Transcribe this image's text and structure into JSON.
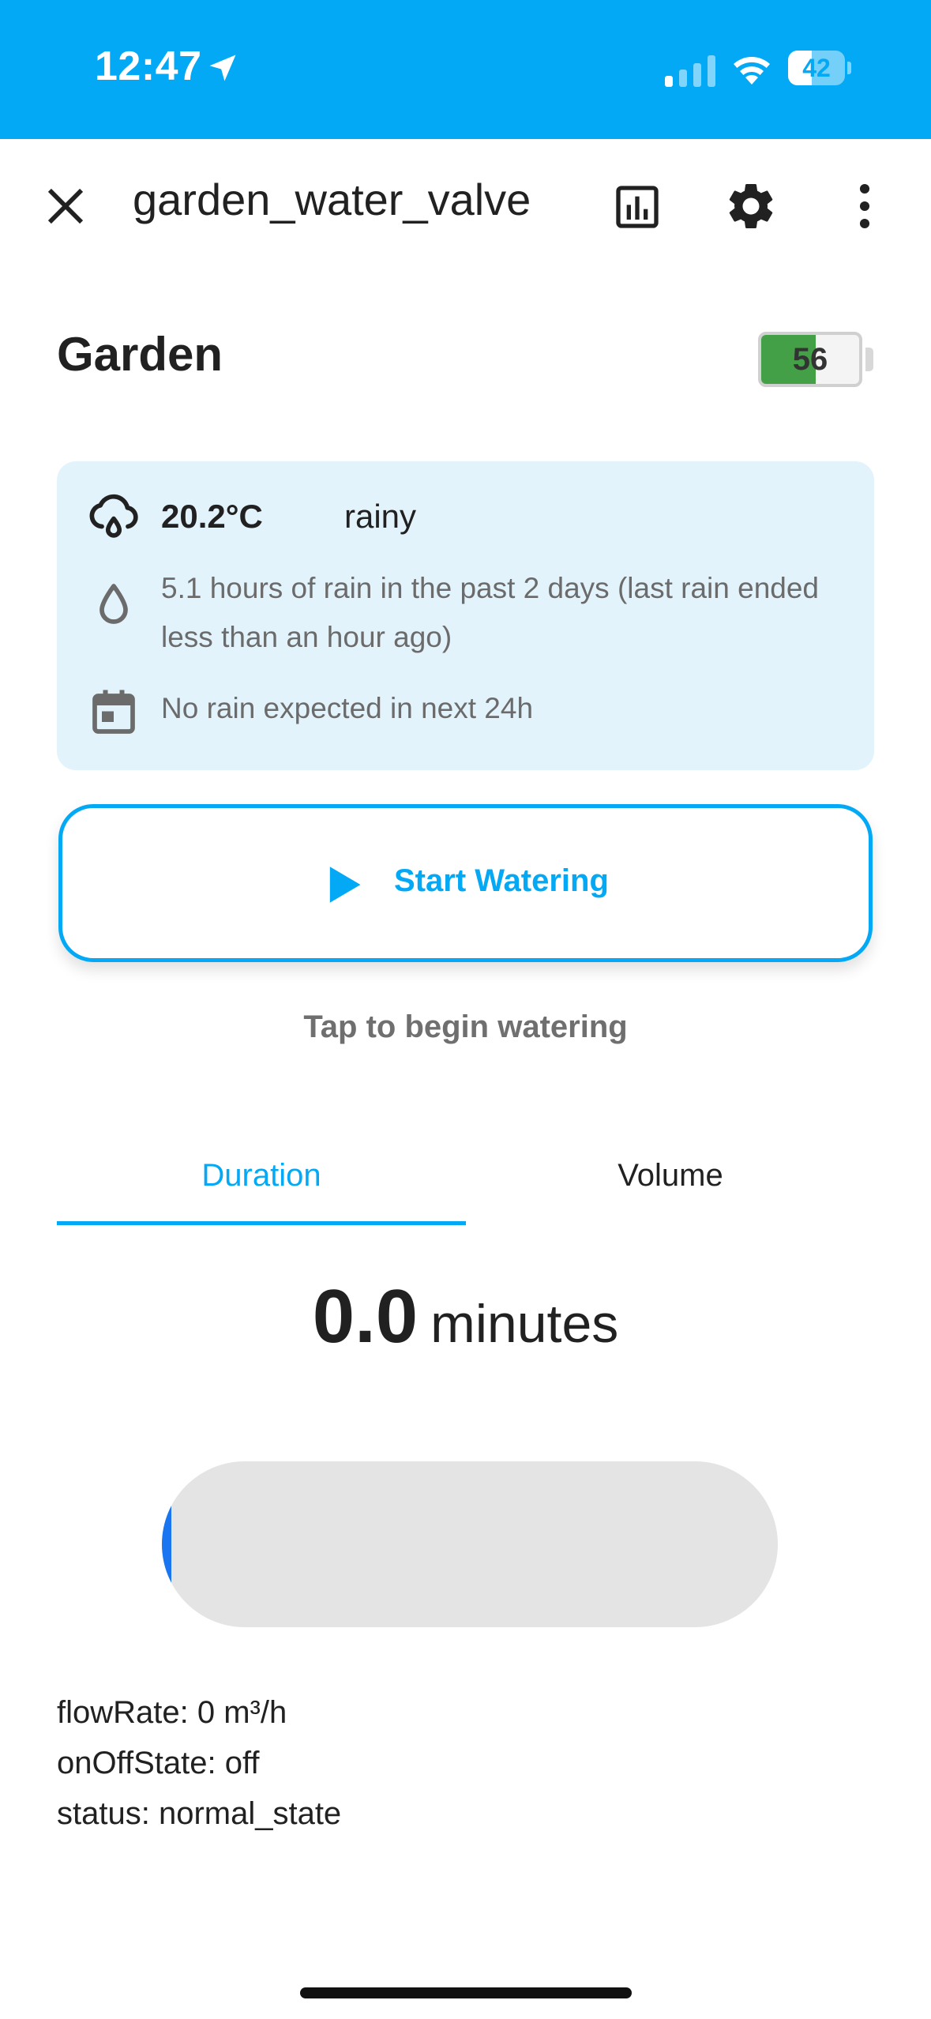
{
  "status_bar": {
    "time": "12:47",
    "battery_level": "42",
    "battery_fraction": 0.42,
    "icons": [
      "location-arrow-icon",
      "cellular-signal-icon",
      "wifi-icon",
      "battery-icon"
    ],
    "background_color": "#03a9f4"
  },
  "header": {
    "title": "garden_water_valve",
    "icons": [
      "close-icon",
      "history-chart-icon",
      "settings-gear-icon",
      "more-vertical-icon"
    ]
  },
  "device": {
    "name": "Garden",
    "battery_level": "56",
    "battery_fraction": 0.56,
    "battery_color": "#43a047"
  },
  "weather": {
    "temperature": "20.2°C",
    "condition": "rainy",
    "rain_history": "5.1 hours of rain in the past 2 days (last rain ended less than an hour ago)",
    "forecast": "No rain expected in next 24h",
    "icons": [
      "cloud-rain-icon",
      "water-drop-icon",
      "calendar-icon"
    ],
    "card_color": "#e3f3fc"
  },
  "start_button": {
    "label": "Start Watering",
    "icon": "play-icon",
    "accent_color": "#03a9f4"
  },
  "start_hint": "Tap to begin watering",
  "tabs": [
    {
      "label": "Duration",
      "active": true
    },
    {
      "label": "Volume",
      "active": false
    }
  ],
  "value_display": {
    "number": "0.0",
    "unit": "minutes"
  },
  "slider": {
    "level_fraction": 0.0,
    "handle_color": "#1976f0"
  },
  "attributes": [
    "flowRate: 0 m³/h",
    "onOffState: off",
    "status: normal_state"
  ]
}
